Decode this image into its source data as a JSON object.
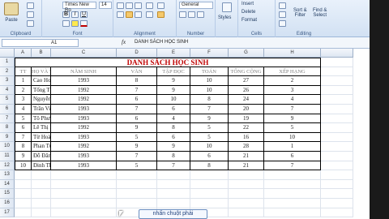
{
  "ribbon": {
    "paste_label": "Paste",
    "clipboard_label": "Clipboard",
    "font_name": "Times New Ro",
    "font_size": "14",
    "font_label": "Font",
    "alignment_label": "Alignment",
    "number_format": "General",
    "number_label": "Number",
    "styles_label": "Styles",
    "insert_label": "Insert",
    "delete_label": "Delete",
    "format_label": "Format",
    "cells_label": "Cells",
    "sort_label": "Sort &",
    "filter_label": "Filter",
    "find_label": "Find &",
    "select_label": "Select",
    "editing_label": "Editing"
  },
  "formula_bar": {
    "name_box": "A1",
    "fx": "fx",
    "content": "DANH SÁCH HỌC SINH"
  },
  "columns": [
    "A",
    "B",
    "C",
    "D",
    "E",
    "F",
    "G",
    "H"
  ],
  "rows": [
    "1",
    "2",
    "3",
    "4",
    "5",
    "6",
    "7",
    "8",
    "9",
    "10",
    "11",
    "12",
    "13",
    "14",
    "15",
    "16",
    "17"
  ],
  "sheet": {
    "title": "DANH SÁCH HỌC SINH",
    "headers": [
      "TT",
      "HỌ VÀ TÊN",
      "NĂM SINH",
      "VĂN",
      "TẬP ĐỌC",
      "TOÁN",
      "TỔNG CỘNG",
      "XẾP HẠNG"
    ],
    "records": [
      [
        "1",
        "Cao Hoàng Hiệp",
        "1993",
        "8",
        "9",
        "10",
        "27",
        "2"
      ],
      [
        "2",
        "Tống Thị Mỹ Nga",
        "1992",
        "7",
        "9",
        "10",
        "26",
        "3"
      ],
      [
        "3",
        "Nguyễn Sơn Hà",
        "1992",
        "6",
        "10",
        "8",
        "24",
        "4"
      ],
      [
        "4",
        "Trần Vinh Sơn",
        "1993",
        "7",
        "6",
        "7",
        "20",
        "7"
      ],
      [
        "5",
        "Tô Phương Lâm",
        "1993",
        "6",
        "4",
        "9",
        "19",
        "9"
      ],
      [
        "6",
        "Lê Thị Mỹ Hạnh",
        "1992",
        "9",
        "8",
        "5",
        "22",
        "5"
      ],
      [
        "7",
        "Từ Hoàng Nam",
        "1993",
        "5",
        "6",
        "5",
        "16",
        "10"
      ],
      [
        "8",
        "Phan Tường Linh",
        "1992",
        "9",
        "9",
        "10",
        "28",
        "1"
      ],
      [
        "9",
        "Đỗ Đăng Khoa",
        "1993",
        "7",
        "8",
        "6",
        "21",
        "6"
      ],
      [
        "10",
        "Đinh Thuý Hương",
        "1993",
        "5",
        "7",
        "8",
        "21",
        "7"
      ]
    ]
  },
  "tooltip": "nhấn chuột phải",
  "colors": {
    "title_red": "#c00000",
    "header_grey": "#808080",
    "ribbon_blue": "#d2e1f3"
  }
}
